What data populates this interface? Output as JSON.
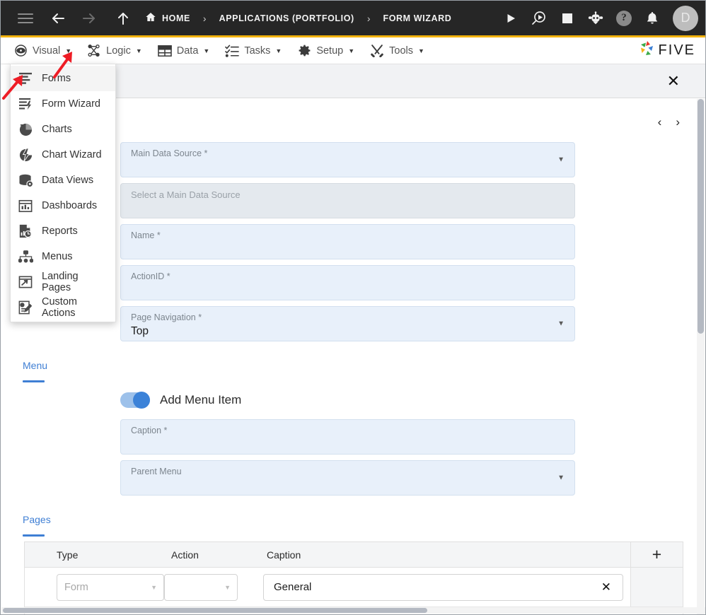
{
  "topbar": {
    "icons": [
      "menu-icon",
      "back-arrow-icon",
      "forward-arrow-icon",
      "up-arrow-icon"
    ],
    "breadcrumbs": [
      {
        "label": "HOME",
        "icon": "home-icon"
      },
      {
        "label": "APPLICATIONS (PORTFOLIO)",
        "icon": ""
      },
      {
        "label": "FORM WIZARD",
        "icon": ""
      }
    ],
    "separator": "›",
    "right_icons": [
      "play-icon",
      "debug-search-icon",
      "stop-icon",
      "robot-icon",
      "help-icon",
      "bell-icon"
    ],
    "help_glyph": "?",
    "avatar_initial": "D"
  },
  "menubar": {
    "items": [
      {
        "label": "Visual",
        "icon": "eye-icon",
        "caret": "▼"
      },
      {
        "label": "Logic",
        "icon": "logic-nodes-icon",
        "caret": "▼"
      },
      {
        "label": "Data",
        "icon": "table-grid-icon",
        "caret": "▼"
      },
      {
        "label": "Tasks",
        "icon": "checklist-icon",
        "caret": "▼"
      },
      {
        "label": "Setup",
        "icon": "gear-icon",
        "caret": "▼"
      },
      {
        "label": "Tools",
        "icon": "tools-icon",
        "caret": "▼"
      }
    ],
    "logo_text": "FIVE",
    "logo_icon": "five-star-logo-icon"
  },
  "dropdown": {
    "open_for": "Visual",
    "items": [
      {
        "label": "Forms",
        "icon": "forms-icon",
        "active": true
      },
      {
        "label": "Form Wizard",
        "icon": "form-wizard-icon",
        "active": false
      },
      {
        "label": "Charts",
        "icon": "charts-pie-icon",
        "active": false
      },
      {
        "label": "Chart Wizard",
        "icon": "chart-wizard-icon",
        "active": false
      },
      {
        "label": "Data Views",
        "icon": "data-views-icon",
        "active": false
      },
      {
        "label": "Dashboards",
        "icon": "dashboards-icon",
        "active": false
      },
      {
        "label": "Reports",
        "icon": "reports-icon",
        "active": false
      },
      {
        "label": "Menus",
        "icon": "menus-tree-icon",
        "active": false
      },
      {
        "label": "Landing Pages",
        "icon": "landing-pages-icon",
        "active": false
      },
      {
        "label": "Custom Actions",
        "icon": "custom-actions-icon",
        "active": false
      }
    ]
  },
  "modal": {
    "close_label": "✕",
    "prev_label": "‹",
    "next_label": "›"
  },
  "form": {
    "fields": [
      {
        "label": "Main Data Source *",
        "value": "",
        "type": "select",
        "caret": "▼"
      },
      {
        "label": "Select a Main Data Source",
        "value": "",
        "type": "placeholder-panel",
        "caret": ""
      },
      {
        "label": "Name *",
        "value": "",
        "type": "text",
        "caret": ""
      },
      {
        "label": "ActionID *",
        "value": "",
        "type": "text",
        "caret": ""
      },
      {
        "label": "Page Navigation *",
        "value": "Top",
        "type": "select",
        "caret": "▼"
      }
    ]
  },
  "menu_section": {
    "title": "Menu",
    "toggle_label": "Add Menu Item",
    "toggle_on": true,
    "fields": [
      {
        "label": "Caption *",
        "value": "",
        "type": "text",
        "caret": ""
      },
      {
        "label": "Parent Menu",
        "value": "",
        "type": "select",
        "caret": "▼"
      }
    ]
  },
  "pages_section": {
    "title": "Pages",
    "add_label": "+",
    "columns": [
      "Type",
      "Action",
      "Caption"
    ],
    "rows": [
      {
        "type": "Form",
        "type_is_placeholder": true,
        "action": "",
        "caption": "General",
        "clear_label": "✕",
        "caret": "▼"
      }
    ]
  },
  "colors": {
    "topbar_bg": "#262626",
    "accent_yellow": "#F2B20C",
    "field_bg": "#e8f0fa",
    "section_blue": "#3f7fd4",
    "toggle_on": "#3b82d8",
    "annotation_red": "#ee1c25"
  }
}
